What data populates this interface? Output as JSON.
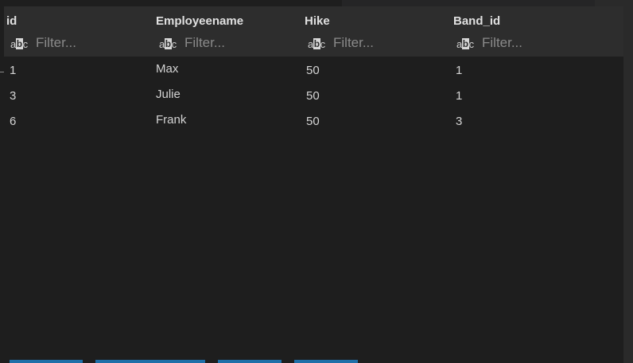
{
  "table": {
    "columns": [
      {
        "key": "id",
        "title": "id",
        "filter_placeholder": "Filter...",
        "filter_value": ""
      },
      {
        "key": "employeename",
        "title": "Employeename",
        "filter_placeholder": "Filter...",
        "filter_value": ""
      },
      {
        "key": "hike",
        "title": "Hike",
        "filter_placeholder": "Filter...",
        "filter_value": ""
      },
      {
        "key": "band_id",
        "title": "Band_id",
        "filter_placeholder": "Filter...",
        "filter_value": ""
      }
    ],
    "filter_icon": {
      "name": "text-filter-icon",
      "glyph_a": "a",
      "glyph_b": "b",
      "glyph_c": "c"
    },
    "rows": [
      {
        "id": "1",
        "employeename": "Max",
        "hike": "50",
        "band_id": "1"
      },
      {
        "id": "3",
        "employeename": "Julie",
        "hike": "50",
        "band_id": "1"
      },
      {
        "id": "6",
        "employeename": "Frank",
        "hike": "50",
        "band_id": "3"
      }
    ]
  },
  "colors": {
    "background": "#1e1e1e",
    "header": "#2d2d2d",
    "accent": "#1f6fa8"
  }
}
